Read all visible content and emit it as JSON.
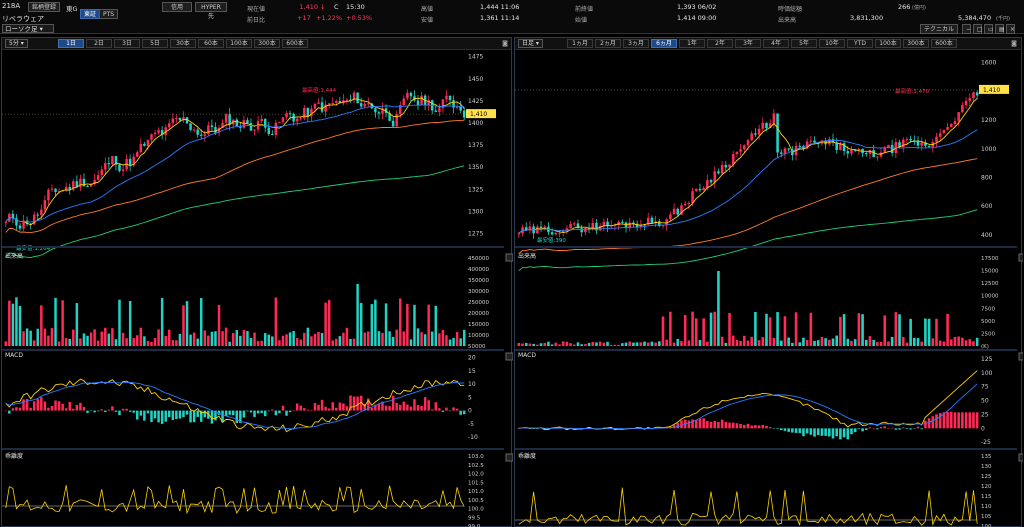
{
  "header": {
    "code": "218A",
    "register_btn": "銘柄登録",
    "market": "東G",
    "tab_tse": "東証",
    "tab_pts": "PTS",
    "name": "リベラウェア",
    "dropdown": "ローソク足",
    "btn_credit": "信用",
    "btn_hyper": "HYPER先",
    "current_label": "現在値",
    "current_value": "1,410",
    "current_arrow": "↓",
    "current_c": "C",
    "current_time": "15:30",
    "change_label": "前日比",
    "change_value": "+17",
    "change_pct1": "+1.22%",
    "change_pct2": "+0.53%",
    "high_label": "高値",
    "high_value": "1,444 11:06",
    "low_label": "安値",
    "low_value": "1,361 11:14",
    "prevclose_label": "前終値",
    "prevclose_value": "1,393 06/02",
    "open_label": "始値",
    "open_value": "1,414 09:00",
    "mcap_label": "時価総額",
    "mcap_value": "266",
    "mcap_unit": "(億円)",
    "volume_label": "出来高",
    "volume_value": "3,831,300",
    "turnover_value": "5,384,470",
    "turnover_unit": "(千円)",
    "technical_btn": "テクニカル"
  },
  "left": {
    "interval_select": "5分",
    "ranges": [
      "1日",
      "2日",
      "3日",
      "5日",
      "30本",
      "60本",
      "100本",
      "300本",
      "600本"
    ],
    "active_range": "1日",
    "price_ticks": [
      "1475",
      "1450",
      "1425",
      "1400",
      "1375",
      "1350",
      "1325",
      "1300",
      "1275"
    ],
    "price_tag": "1,410",
    "high_note": "最高値:1,444",
    "low_note": "最安値:1,264",
    "vol_title": "出来高",
    "vol_ticks": [
      "450000",
      "400000",
      "350000",
      "300000",
      "250000",
      "200000",
      "150000",
      "100000",
      "50000"
    ],
    "macd_title": "MACD",
    "macd_ticks": [
      "20",
      "15",
      "10",
      "5",
      "0",
      "-5",
      "-10"
    ],
    "dev_title": "乖離度",
    "dev_ticks": [
      "103.0",
      "102.5",
      "102.0",
      "101.5",
      "101.0",
      "100.5",
      "100.0",
      "99.5",
      "99.0"
    ]
  },
  "right": {
    "interval_select": "日足",
    "ranges": [
      "1ヵ月",
      "2ヵ月",
      "3ヵ月",
      "6ヵ月",
      "1年",
      "2年",
      "3年",
      "4年",
      "5年",
      "10年",
      "YTD",
      "100本",
      "300本",
      "600本"
    ],
    "active_range": "6ヵ月",
    "price_ticks": [
      "1600",
      "1400",
      "1200",
      "1000",
      "800",
      "600",
      "400"
    ],
    "price_tag": "1,410",
    "high_note": "最高値:1,470",
    "low_note": "最安値:390",
    "vol_title": "出来高",
    "vol_ticks": [
      "17500",
      "15000",
      "12500",
      "10000",
      "7500",
      "5000",
      "2500",
      "(K)"
    ],
    "macd_title": "MACD",
    "macd_ticks": [
      "125",
      "100",
      "75",
      "50",
      "25",
      "0",
      "-25"
    ],
    "dev_title": "乖離度",
    "dev_ticks": [
      "135",
      "130",
      "125",
      "120",
      "115",
      "110",
      "105",
      "100"
    ]
  },
  "colors": {
    "up": "#ff2a55",
    "down": "#22d3c5",
    "ma_short": "#ffd400",
    "ma_mid": "#2a7cff",
    "ma_long": "#ff7a2a",
    "ma_xlong": "#1fd07a"
  }
}
